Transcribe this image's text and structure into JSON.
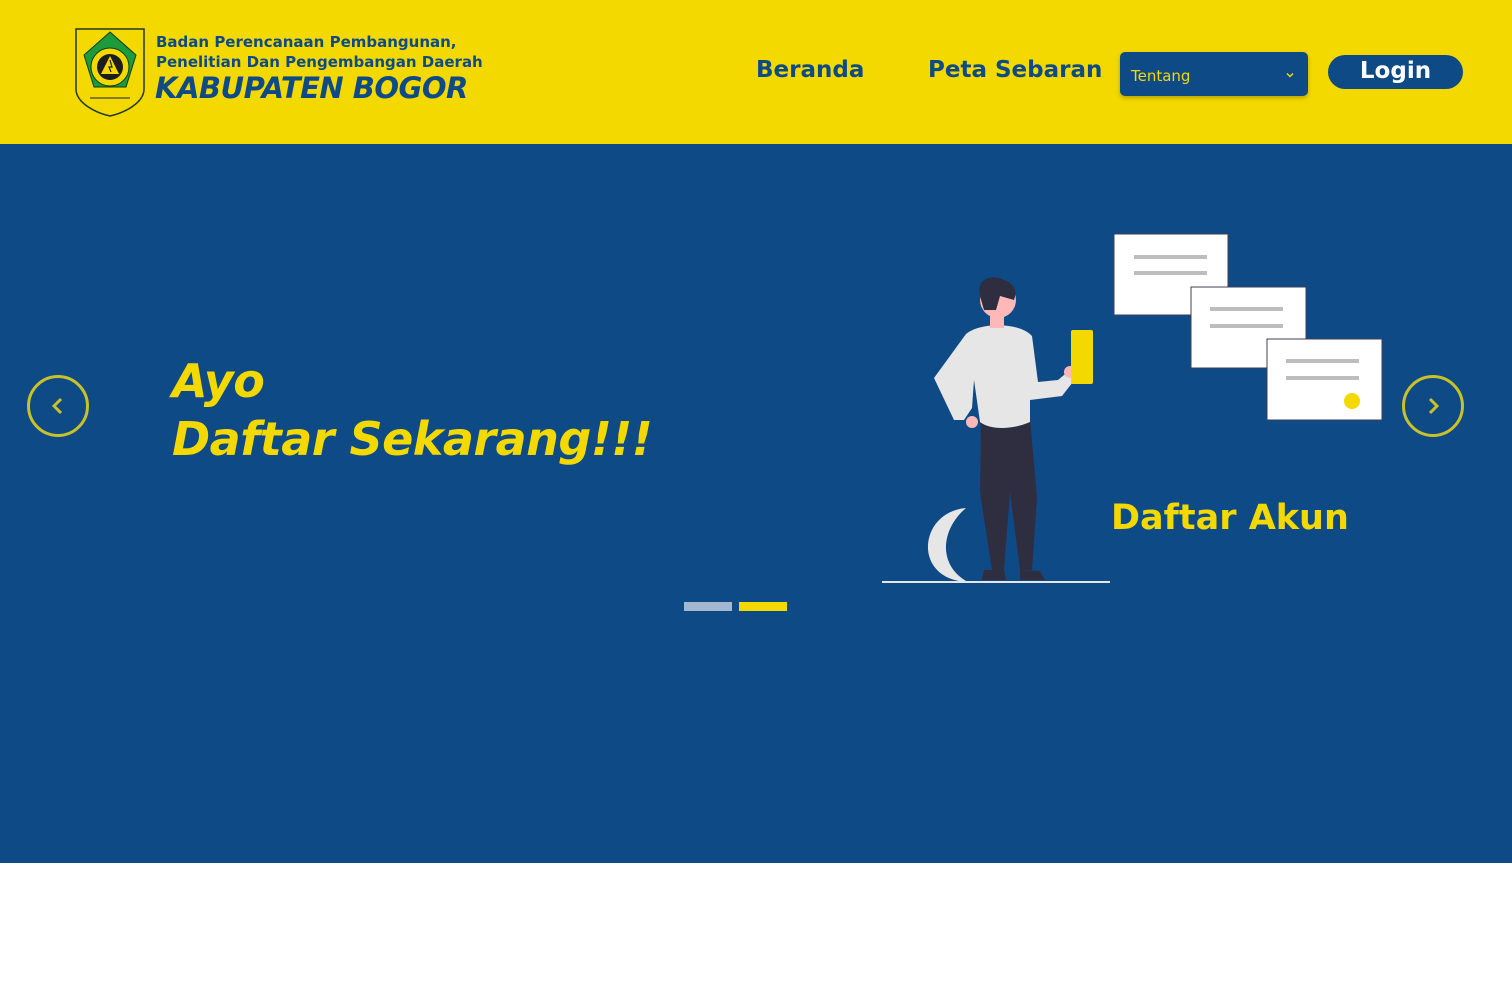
{
  "colors": {
    "brand_yellow": "#F3D900",
    "brand_blue": "#0E4A86",
    "white": "#FFFFFF"
  },
  "header": {
    "logo_icon": "kabupaten-bogor-emblem-icon",
    "brand_line1": "Badan Perencanaan Pembangunan,",
    "brand_line2": "Penelitian Dan Pengembangan Daerah",
    "brand_title": "KABUPATEN BOGOR",
    "nav": {
      "beranda": "Beranda",
      "peta_sebaran": "Peta Sebaran",
      "tentang_select": {
        "value": "Tentang",
        "icon": "chevron-down-icon"
      },
      "login": "Login"
    }
  },
  "hero": {
    "headline_line1": "Ayo",
    "headline_line2": "Daftar Sekarang!!!",
    "slide_caption": "Daftar Akun",
    "illustration": "person-holding-phone-with-invoice-cards",
    "prev_icon": "chevron-left-icon",
    "next_icon": "chevron-right-icon",
    "carousel": {
      "slide_count": 2,
      "active_slide": 2
    }
  }
}
